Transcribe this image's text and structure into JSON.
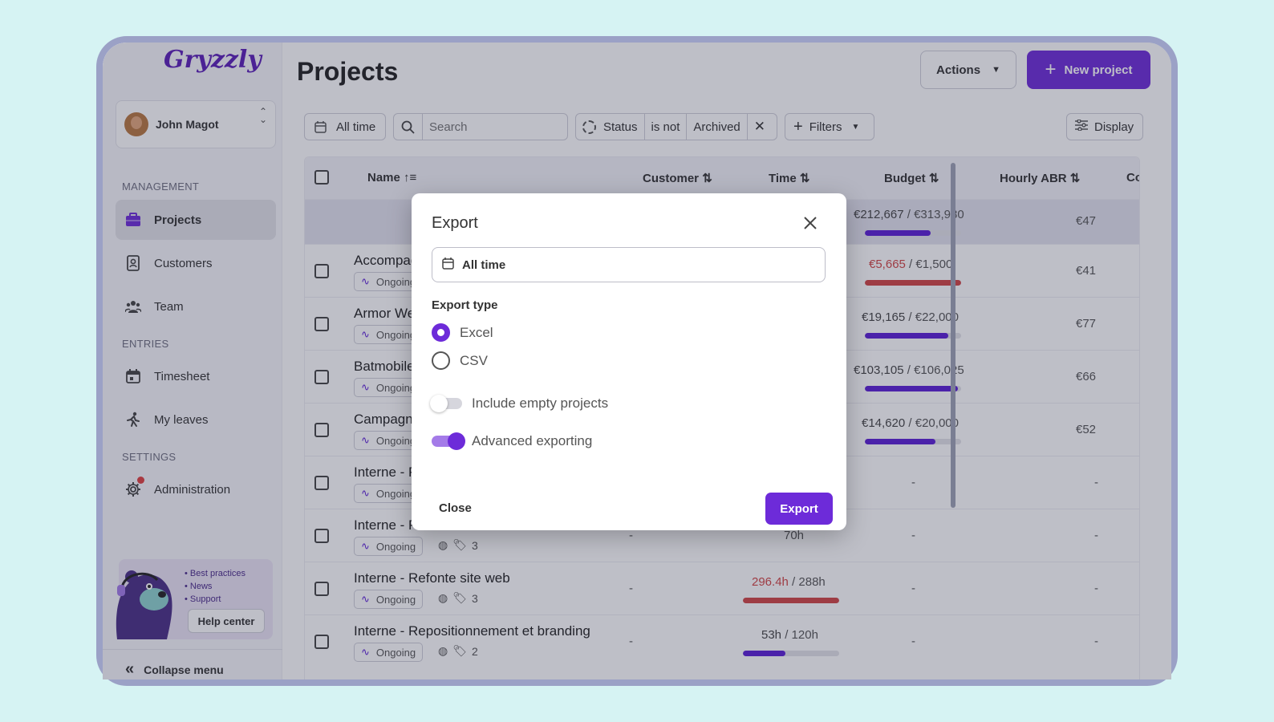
{
  "brand": {
    "logo_text": "Gryzzly"
  },
  "user": {
    "name": "John Magot"
  },
  "sidebar": {
    "sections": [
      {
        "label": "MANAGEMENT"
      },
      {
        "label": "ENTRIES"
      },
      {
        "label": "SETTINGS"
      }
    ],
    "items": [
      {
        "label": "Projects",
        "icon": "briefcase-icon",
        "active": true
      },
      {
        "label": "Customers",
        "icon": "contact-card-icon"
      },
      {
        "label": "Team",
        "icon": "team-icon"
      },
      {
        "label": "Timesheet",
        "icon": "calendar-icon"
      },
      {
        "label": "My leaves",
        "icon": "leave-icon"
      },
      {
        "label": "Administration",
        "icon": "gear-icon"
      }
    ],
    "help": {
      "links": [
        "Best practices",
        "News",
        "Support"
      ],
      "button": "Help center"
    },
    "collapse_label": "Collapse menu"
  },
  "header": {
    "title": "Projects",
    "actions_label": "Actions",
    "new_project_label": "New project"
  },
  "filters": {
    "date": "All time",
    "search_placeholder": "Search",
    "status_field": "Status",
    "status_op": "is not",
    "status_value": "Archived",
    "filters_label": "Filters",
    "display_label": "Display"
  },
  "table": {
    "columns": [
      "Name",
      "Customer",
      "Time",
      "Budget",
      "Hourly ABR",
      "Co"
    ],
    "status_tag": "Ongoing",
    "rows": [
      {
        "name": "",
        "budget_used": "€212,667",
        "budget_total": "€313,980",
        "budget_fill": 0.68,
        "abr": "€47"
      },
      {
        "name": "Accompag",
        "budget_used": "€5,665",
        "budget_total": "€1,500",
        "budget_fill": 1.0,
        "budget_over": true,
        "abr": "€41"
      },
      {
        "name": "Armor We",
        "budget_used": "€19,165",
        "budget_total": "€22,000",
        "budget_fill": 0.87,
        "abr": "€77"
      },
      {
        "name": "Batmobile",
        "budget_used": "€103,105",
        "budget_total": "€106,025",
        "budget_fill": 0.97,
        "abr": "€66"
      },
      {
        "name": "Campagne",
        "budget_used": "€14,620",
        "budget_total": "€20,000",
        "budget_fill": 0.73,
        "abr": "€52"
      },
      {
        "name": "Interne - P",
        "budget": "-",
        "abr": "-"
      },
      {
        "name": "Interne - P",
        "customer": "-",
        "time": "70h",
        "tags": "3",
        "budget": "-",
        "abr": "-"
      },
      {
        "name": "Interne - Refonte site web",
        "customer": "-",
        "time_used": "296.4h",
        "time_total": "288h",
        "time_fill": 1.0,
        "time_over": true,
        "tags": "3",
        "budget": "-",
        "abr": "-"
      },
      {
        "name": "Interne - Repositionnement et branding",
        "customer": "-",
        "time_used": "53h",
        "time_total": "120h",
        "time_fill": 0.44,
        "tags": "2",
        "budget": "-",
        "abr": "-"
      }
    ]
  },
  "modal": {
    "title": "Export",
    "date": "All time",
    "type_label": "Export type",
    "options": [
      {
        "label": "Excel",
        "selected": true
      },
      {
        "label": "CSV",
        "selected": false
      }
    ],
    "toggles": [
      {
        "label": "Include empty projects",
        "on": false
      },
      {
        "label": "Advanced exporting",
        "on": true
      }
    ],
    "close_label": "Close",
    "export_label": "Export"
  },
  "colors": {
    "accent": "#6d2bd9",
    "danger": "#d24444"
  }
}
